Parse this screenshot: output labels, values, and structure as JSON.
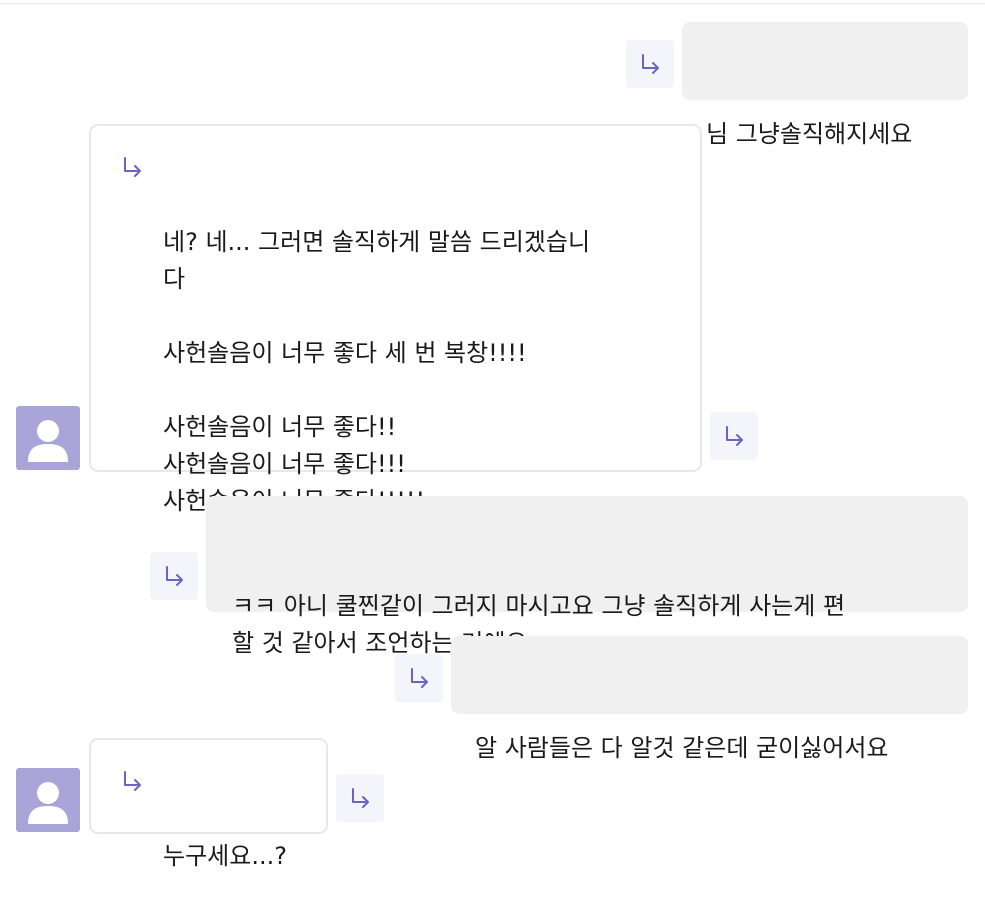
{
  "theme": {
    "accent": "#6b63c6",
    "avatar_bg": "#a9a5d8",
    "sent_bubble_bg": "#f0f0f0",
    "received_bubble_border": "#e8e8e8",
    "reply_button_bg": "#f4f4fb"
  },
  "icons": {
    "reply": "reply-arrow-icon",
    "avatar": "person-icon"
  },
  "messages": [
    {
      "direction": "sent",
      "text": "님 그냥솔직해지세요"
    },
    {
      "direction": "received",
      "text": "네? 네... 그러면 솔직하게 말씀 드리겠습니\n다\n\n사헌솔음이 너무 좋다 세 번 복창!!!!\n\n사헌솔음이 너무 좋다!!\n사헌솔음이 너무 좋다!!!\n사헌솔음이 너무 좋다!!!!!"
    },
    {
      "direction": "sent",
      "text": "ㅋㅋ 아니 쿨찐같이 그러지 마시고요 그냥 솔직하게 사는게 편\n할 것 같아서 조언하는 거에요"
    },
    {
      "direction": "sent",
      "text": "알 사람들은 다 알것 같은데 굳이싫어서요"
    },
    {
      "direction": "received",
      "text": "누구세요...?"
    }
  ]
}
